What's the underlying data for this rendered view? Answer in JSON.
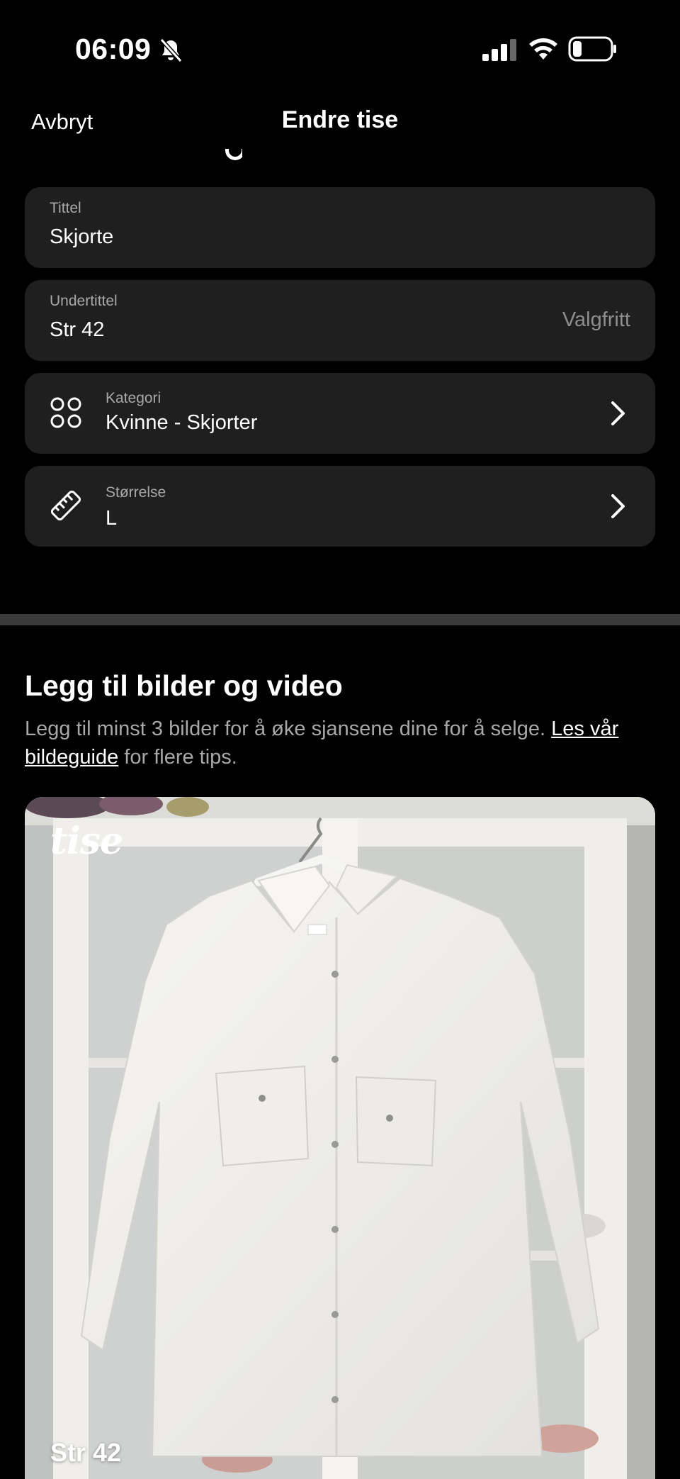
{
  "status_bar": {
    "time": "06:09"
  },
  "nav": {
    "cancel_label": "Avbryt",
    "title": "Endre tise"
  },
  "fields": {
    "title": {
      "label": "Tittel",
      "value": "Skjorte"
    },
    "subtitle": {
      "label": "Undertittel",
      "value": "Str 42",
      "hint": "Valgfritt"
    },
    "category": {
      "label": "Kategori",
      "value": "Kvinne - Skjorter",
      "icon": "grid-icon"
    },
    "size": {
      "label": "Størrelse",
      "value": "L",
      "icon": "ruler-icon"
    }
  },
  "media_section": {
    "title": "Legg til bilder og video",
    "description_prefix": "Legg til minst 3 bilder for å øke sjansene dine for å selge.",
    "guide_link": "Les vår bildeguide",
    "description_suffix": "for flere tips."
  },
  "photo": {
    "watermark": "tise",
    "caption": "Str 42"
  },
  "colors": {
    "background": "#000000",
    "field_background": "#1f1f1f",
    "divider": "#3a3a3a",
    "muted_text": "#a8a8a8"
  }
}
